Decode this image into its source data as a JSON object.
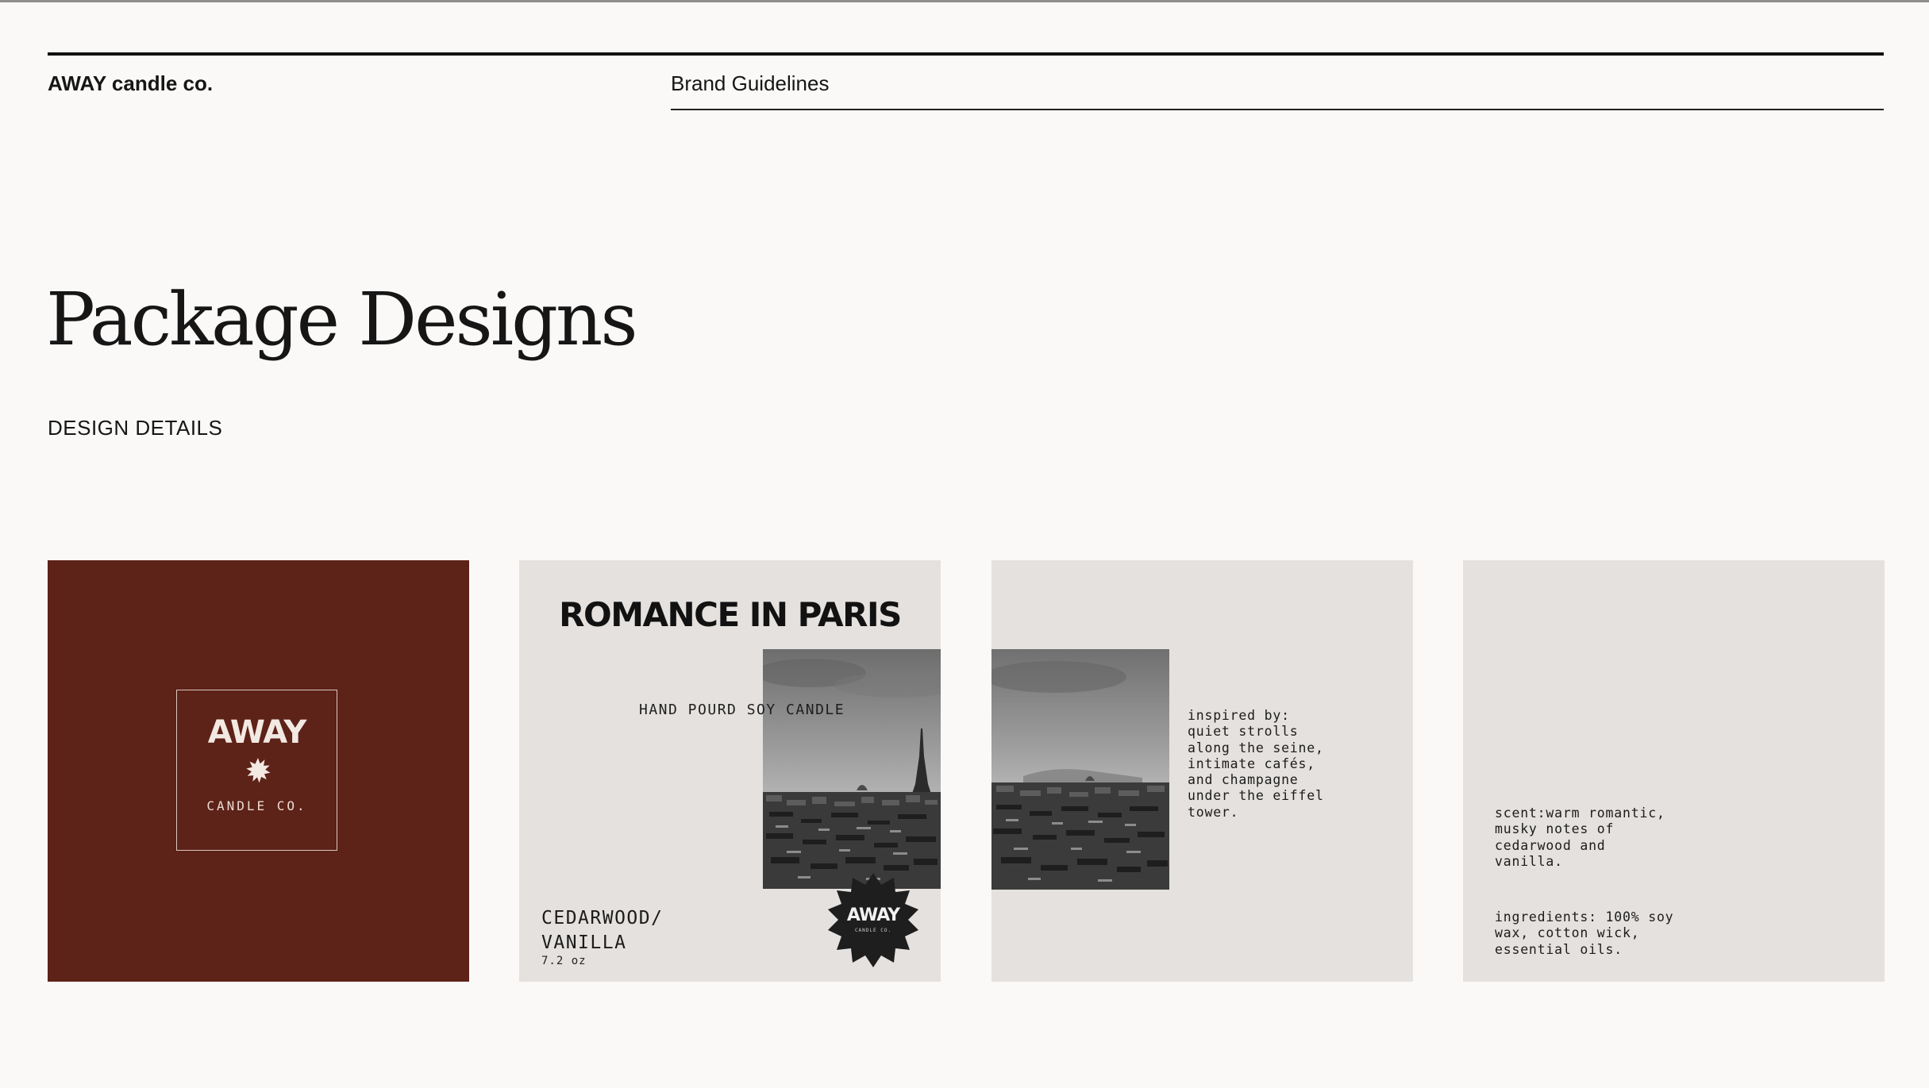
{
  "header": {
    "brand": "AWAY candle co.",
    "section": "Brand Guidelines"
  },
  "page": {
    "title": "Package Designs",
    "subtitle": "DESIGN DETAILS"
  },
  "colors": {
    "background": "#faf9f7",
    "brand_red": "#5d2218",
    "panel_grey": "#e4e1de",
    "ink": "#161616"
  },
  "panels": {
    "logo": {
      "word": "AWAY",
      "icon": "sunburst-icon",
      "sub": "CANDLE  CO."
    },
    "front": {
      "title": "ROMANCE IN PARIS",
      "subtitle": "HAND POURD SOY CANDLE",
      "scent": "CEDARWOOD/\nVANILLA",
      "weight": "7.2 oz",
      "photo": "paris-skyline-eiffel-photo",
      "badge_word": "AWAY",
      "badge_sub": "CANDLE CO."
    },
    "story": {
      "photo": "paris-skyline-photo",
      "text": "inspired by:\nquiet strolls\nalong the seine,\nintimate cafés,\nand champagne\nunder the eiffel\ntower."
    },
    "details": {
      "scent": "scent:warm romantic,\nmusky notes of\ncedarwood and\nvanilla.",
      "ingredients": "ingredients: 100% soy\nwax, cotton wick,\nessential oils."
    }
  }
}
